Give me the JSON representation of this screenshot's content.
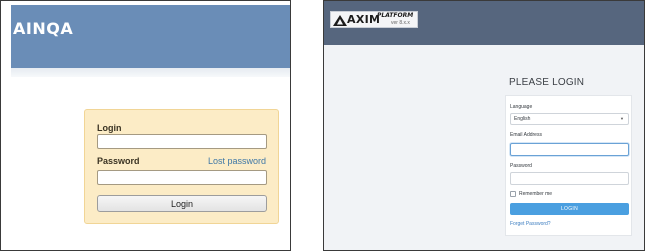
{
  "left": {
    "brand": "AINQA",
    "form": {
      "login_label": "Login",
      "login_value": "",
      "password_label": "Password",
      "password_value": "",
      "lost_password_link": "Lost password",
      "login_button": "Login"
    },
    "colors": {
      "header": "#6a8db7",
      "form_bg": "#fcecc6",
      "link": "#3e77a6"
    }
  },
  "right": {
    "logo": {
      "name": "AXIM",
      "sub": "PLATFORM",
      "version": "ver 8.x.x"
    },
    "heading": "PLEASE LOGIN",
    "form": {
      "language_label": "Language",
      "language_value": "English",
      "email_label": "Email Address",
      "email_value": "",
      "password_label": "Password",
      "password_value": "",
      "remember_label": "Remember me",
      "remember_checked": false,
      "login_button": "LOGIN",
      "forgot_link": "Forget Password?"
    },
    "colors": {
      "header": "#56667e",
      "button": "#4a9fe0",
      "link": "#3f7fc1"
    }
  }
}
